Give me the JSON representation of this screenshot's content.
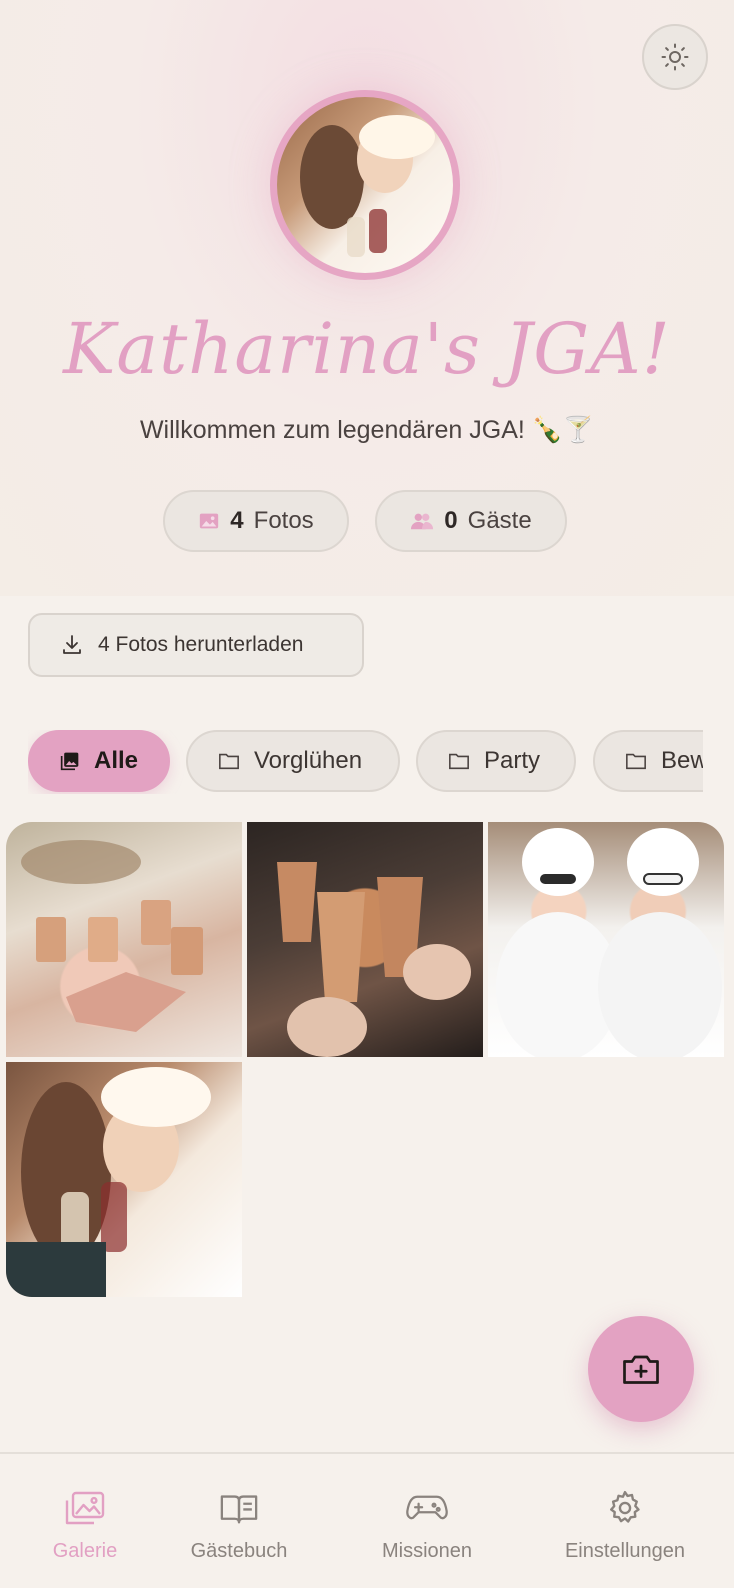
{
  "header": {
    "title": "Katharina's JGA!",
    "subtitle": "Willkommen zum legendären JGA! 🍾🍸"
  },
  "stats": [
    {
      "count": "4",
      "label": "Fotos",
      "icon": "image-icon"
    },
    {
      "count": "0",
      "label": "Gäste",
      "icon": "users-icon"
    }
  ],
  "download": {
    "label": "4 Fotos herunterladen"
  },
  "filters": [
    {
      "label": "Alle",
      "active": true
    },
    {
      "label": "Vorglühen"
    },
    {
      "label": "Party"
    },
    {
      "label": "Bew"
    }
  ],
  "gallery": {
    "photo_count": 4
  },
  "nav": {
    "items": [
      {
        "label": "Galerie",
        "active": true
      },
      {
        "label": "Gästebuch"
      },
      {
        "label": "Missionen"
      },
      {
        "label": "Einstellungen"
      }
    ]
  },
  "colors": {
    "accent": "#e3a2c2",
    "background": "#f6f1ec",
    "muted": "#8a837e"
  }
}
